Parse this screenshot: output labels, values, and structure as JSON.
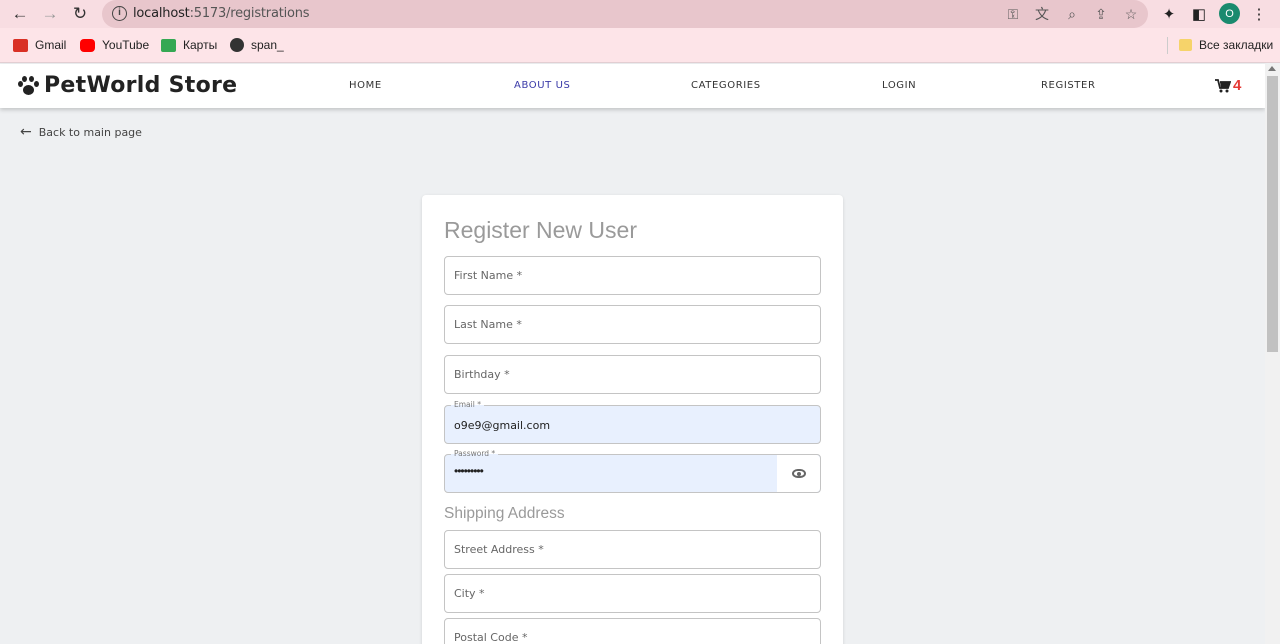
{
  "browser": {
    "url_host": "localhost",
    "url_path": ":5173/registrations",
    "profile_initial": "O",
    "bookmarks": [
      {
        "label": "Gmail",
        "icon": "gmail-icon",
        "color": "#d93025"
      },
      {
        "label": "YouTube",
        "icon": "youtube-icon",
        "color": "#ff0000"
      },
      {
        "label": "Карты",
        "icon": "maps-icon",
        "color": "#34a853"
      },
      {
        "label": "span_",
        "icon": "globe-icon",
        "color": "#333333"
      }
    ],
    "all_bookmarks_label": "Все закладки"
  },
  "header": {
    "logo_text": "PetWorld Store",
    "nav": [
      {
        "label": "HOME",
        "active": false
      },
      {
        "label": "ABOUT US",
        "active": true
      },
      {
        "label": "CATEGORIES",
        "active": false
      },
      {
        "label": "LOGIN",
        "active": false
      },
      {
        "label": "REGISTER",
        "active": false
      }
    ],
    "cart_count": "4"
  },
  "back_link": "Back to main page",
  "form": {
    "title": "Register New User",
    "first_name_label": "First Name *",
    "last_name_label": "Last Name *",
    "birthday_label": "Birthday *",
    "email_label": "Email *",
    "email_value": "o9e9@gmail.com",
    "password_label": "Password *",
    "password_value": "•••••••••",
    "shipping_title": "Shipping Address",
    "street_label": "Street Address *",
    "city_label": "City *",
    "postal_label": "Postal Code *"
  },
  "colors": {
    "chrome_bg": "#f8dde2",
    "active_nav": "#3a3aa8",
    "cart_badge": "#e53935",
    "autofill_bg": "#e8f0fe"
  }
}
